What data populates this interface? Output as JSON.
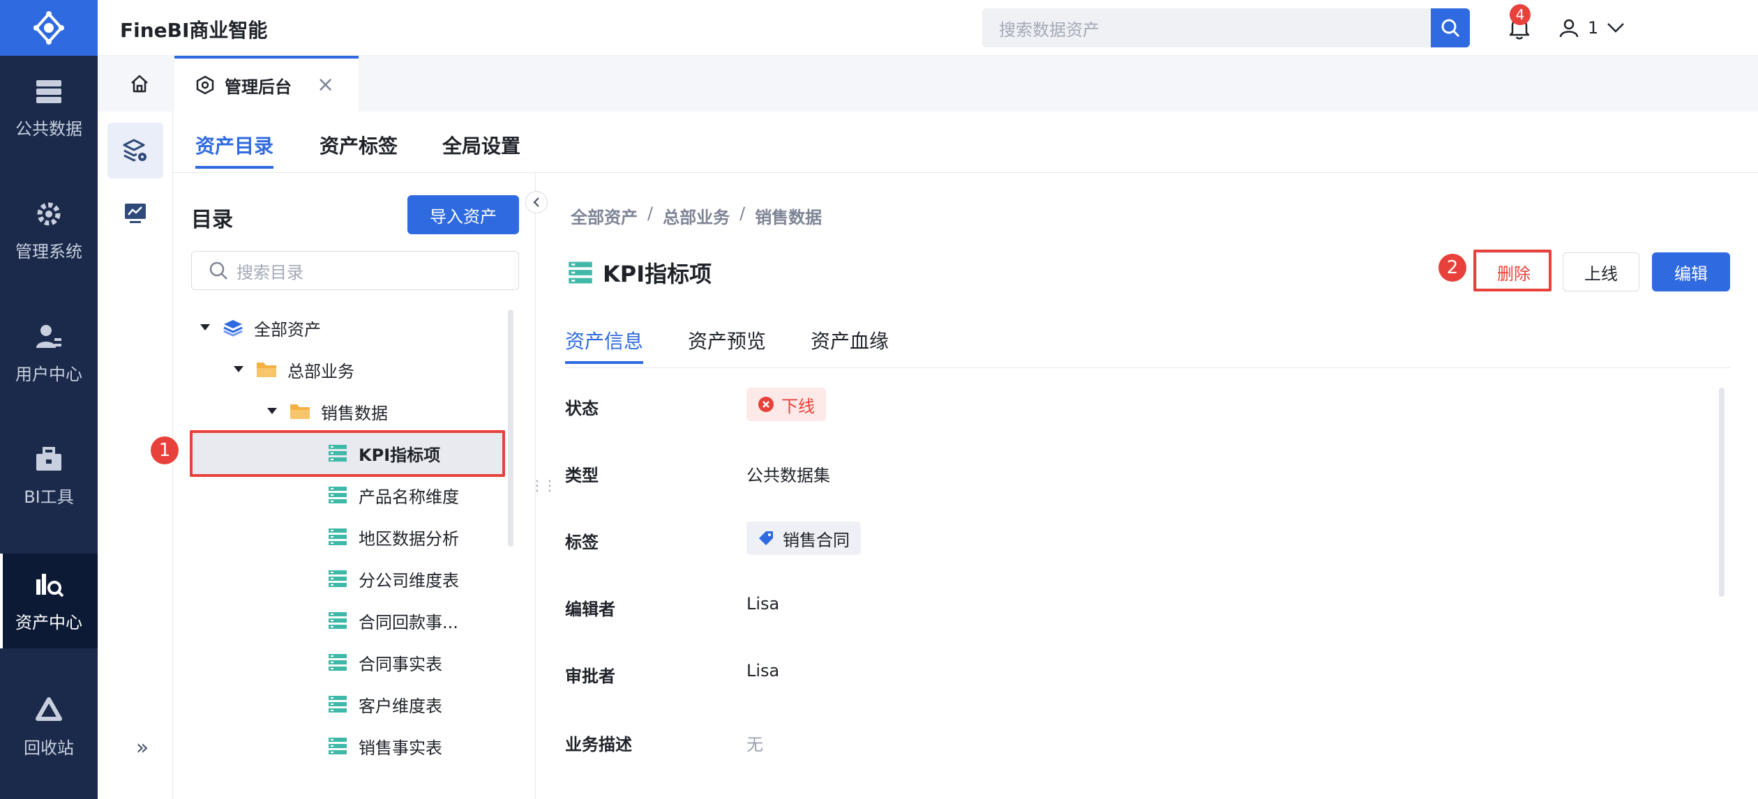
{
  "app": {
    "title": "FineBI商业智能"
  },
  "leftnav": {
    "items": [
      {
        "label": "公共数据",
        "icon": "database-icon"
      },
      {
        "label": "管理系统",
        "icon": "gear-icon"
      },
      {
        "label": "用户中心",
        "icon": "user-icon"
      },
      {
        "label": "BI工具",
        "icon": "toolbox-icon"
      },
      {
        "label": "资产中心",
        "icon": "asset-search-icon",
        "active": true
      },
      {
        "label": "回收站",
        "icon": "recycle-icon"
      }
    ]
  },
  "topbar": {
    "search_placeholder": "搜索数据资产",
    "notification_count": "4",
    "user_name": "1"
  },
  "tabstrip": {
    "admin_tab": "管理后台",
    "close": "×"
  },
  "main_tabs": [
    "资产目录",
    "资产标签",
    "全局设置"
  ],
  "catalog": {
    "title": "目录",
    "import_button": "导入资产",
    "search_placeholder": "搜索目录",
    "tree": [
      {
        "label": "全部资产",
        "level": 0,
        "type": "root"
      },
      {
        "label": "总部业务",
        "level": 1,
        "type": "folder"
      },
      {
        "label": "销售数据",
        "level": 2,
        "type": "folder"
      },
      {
        "label": "KPI指标项",
        "level": 3,
        "type": "table",
        "selected": true
      },
      {
        "label": "产品名称维度",
        "level": 3,
        "type": "table"
      },
      {
        "label": "地区数据分析",
        "level": 3,
        "type": "table"
      },
      {
        "label": "分公司维度表",
        "level": 3,
        "type": "table"
      },
      {
        "label": "合同回款事...",
        "level": 3,
        "type": "table"
      },
      {
        "label": "合同事实表",
        "level": 3,
        "type": "table"
      },
      {
        "label": "客户维度表",
        "level": 3,
        "type": "table"
      },
      {
        "label": "销售事实表",
        "level": 3,
        "type": "table"
      }
    ]
  },
  "steps": {
    "one": "1",
    "two": "2"
  },
  "detail": {
    "breadcrumb": [
      "全部资产",
      "总部业务",
      "销售数据"
    ],
    "separator": "/",
    "title": "KPI指标项",
    "buttons": {
      "delete": "删除",
      "online": "上线",
      "edit": "编辑"
    },
    "tabs": [
      "资产信息",
      "资产预览",
      "资产血缘"
    ],
    "fields": {
      "status_label": "状态",
      "status_value": "下线",
      "type_label": "类型",
      "type_value": "公共数据集",
      "tag_label": "标签",
      "tag_value": "销售合同",
      "editor_label": "编辑者",
      "editor_value": "Lisa",
      "approver_label": "审批者",
      "approver_value": "Lisa",
      "desc_label": "业务描述",
      "desc_value": "无"
    }
  },
  "colors": {
    "accent": "#2f6ae0",
    "danger": "#e8413b",
    "nav_bg": "#1b2a4a",
    "table_icon": "#3fb8a8",
    "folder_icon": "#f5b041"
  }
}
